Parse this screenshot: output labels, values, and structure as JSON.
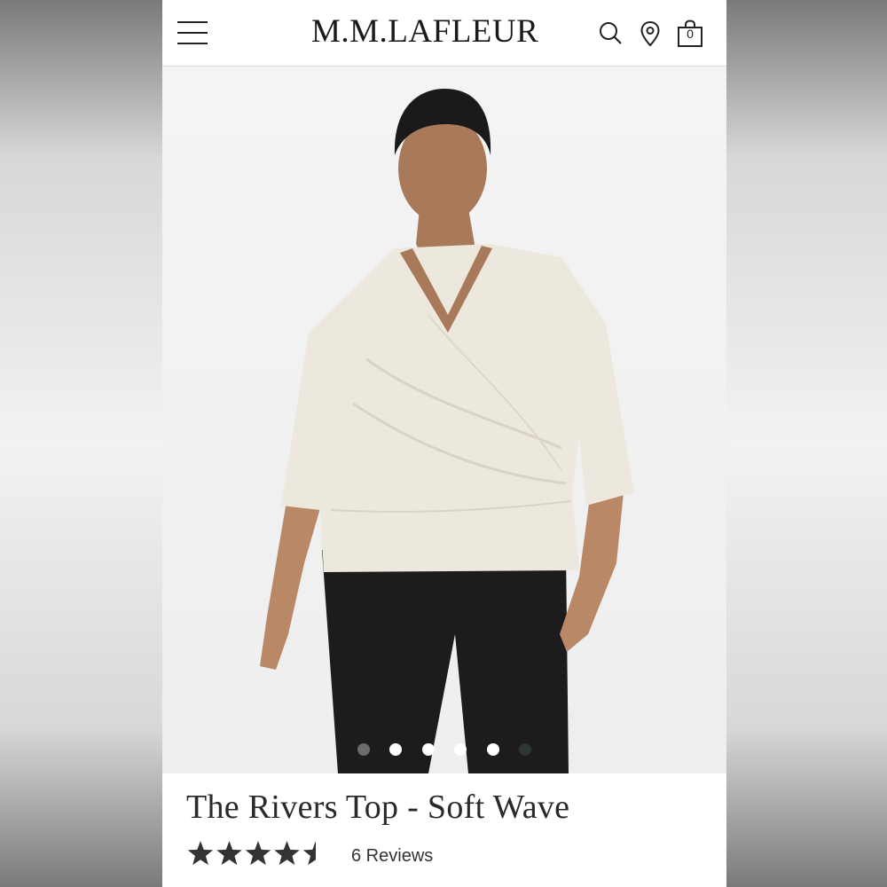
{
  "header": {
    "logo": "M.M.LAFLEUR",
    "cart_count": "0",
    "icons": [
      "hamburger-menu-icon",
      "search-icon",
      "location-pin-icon",
      "shopping-bag-icon"
    ]
  },
  "gallery": {
    "image_count": 6,
    "active_index": 1
  },
  "product": {
    "title": "The Rivers Top - Soft Wave",
    "rating": 4.5,
    "rating_max": 5,
    "reviews_label": "6 Reviews"
  },
  "colors": {
    "top": "#ece8dd",
    "pants": "#1c1c1c",
    "star": "#333333"
  }
}
